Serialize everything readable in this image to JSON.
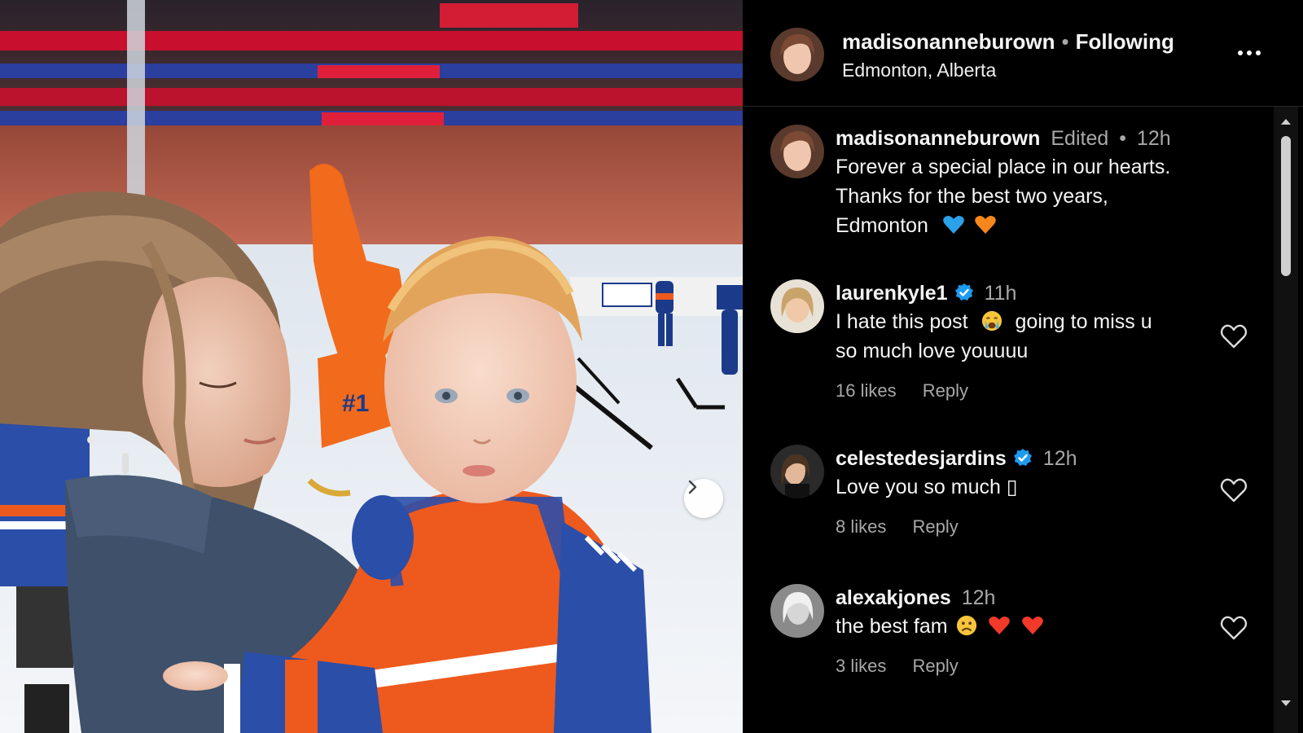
{
  "post": {
    "username": "madisonanneburown",
    "follow_status": "Following",
    "location": "Edmonton, Alberta"
  },
  "comments": [
    {
      "username": "madisonanneburown",
      "edited": "Edited",
      "time": "12h",
      "verified": false,
      "lines": [
        "Forever a special place in our hearts.",
        "Thanks for the best two years,",
        "Edmonton"
      ],
      "emojis": [
        "blue-heart",
        "orange-heart"
      ]
    },
    {
      "username": "laurenkyle1",
      "time": "11h",
      "verified": true,
      "line1": "I hate this post",
      "line1_after": "going to miss u",
      "line2": "so much love youuuu",
      "likes": "16 likes",
      "reply": "Reply"
    },
    {
      "username": "celestedesjardins",
      "time": "12h",
      "verified": true,
      "text": "Love you so much",
      "missing_glyph": "▯",
      "likes": "8 likes",
      "reply": "Reply"
    },
    {
      "username": "alexakjones",
      "time": "12h",
      "verified": false,
      "text": "the best fam",
      "likes": "3 likes",
      "reply": "Reply"
    }
  ],
  "icons": {
    "next": "chevron-right-icon",
    "more": "more-options-icon",
    "like": "heart-outline-icon",
    "verified": "verified-badge-icon"
  },
  "colors": {
    "verified": "#1d9bf0",
    "blue_heart": "#2aa1e8",
    "orange_heart": "#f7861d",
    "red_heart": "#f33a2a",
    "oilers_orange": "#ee5a1e",
    "oilers_blue": "#1b3a8a"
  }
}
